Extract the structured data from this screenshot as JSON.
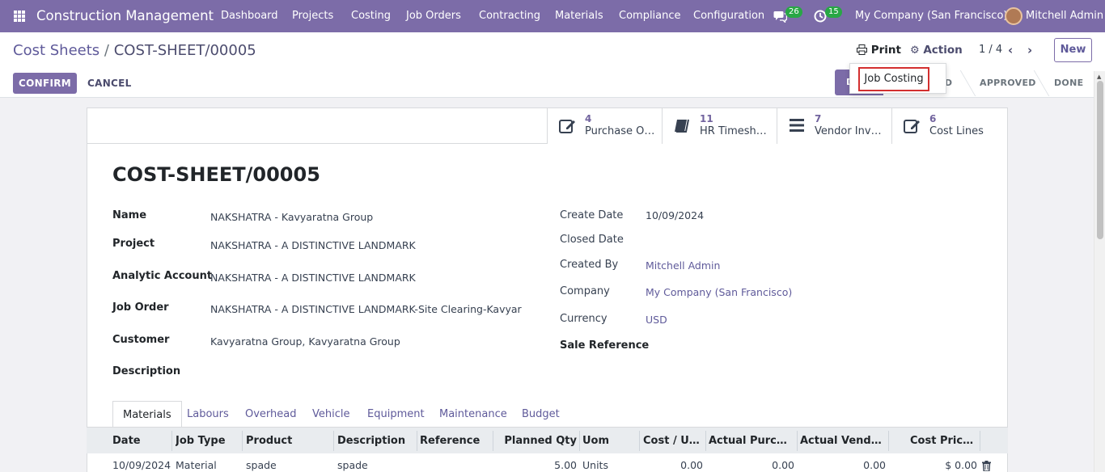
{
  "topbar": {
    "app_title": "Construction Management",
    "menu": [
      "Dashboard",
      "Projects",
      "Costing",
      "Job Orders",
      "Contracting",
      "Materials",
      "Compliance",
      "Configuration"
    ],
    "messages_count": "26",
    "activities_count": "15",
    "company": "My Company (San Francisco)",
    "user": "Mitchell Admin"
  },
  "breadcrumb": {
    "parent": "Cost Sheets",
    "separator": "/",
    "current": "COST-SHEET/00005"
  },
  "toolbar": {
    "print": "Print",
    "action": "Action",
    "pager": "1 / 4",
    "new": "New"
  },
  "actions": {
    "confirm": "CONFIRM",
    "cancel": "CANCEL"
  },
  "print_menu": {
    "item": "Job Costing"
  },
  "statusbar": {
    "draft_partial": "D",
    "confirmed_partial": "ED",
    "approved": "APPROVED",
    "done": "DONE"
  },
  "smart_buttons": [
    {
      "count": "4",
      "label": "Purchase O…",
      "icon": "edit-icon"
    },
    {
      "count": "11",
      "label": "HR Timesh…",
      "icon": "book-icon"
    },
    {
      "count": "7",
      "label": "Vendor Inv…",
      "icon": "list-icon"
    },
    {
      "count": "6",
      "label": "Cost Lines",
      "icon": "edit-icon"
    }
  ],
  "record": {
    "title": "COST-SHEET/00005",
    "left": [
      {
        "label": "Name",
        "value": "NAKSHATRA - Kavyaratna Group"
      },
      {
        "label": "Project",
        "value": "NAKSHATRA - A DISTINCTIVE LANDMARK"
      },
      {
        "label": "Analytic Account",
        "value": "NAKSHATRA - A DISTINCTIVE LANDMARK"
      },
      {
        "label": "Job Order",
        "value": "NAKSHATRA - A DISTINCTIVE LANDMARK-Site Clearing-Kavyar"
      },
      {
        "label": "Customer",
        "value": "Kavyaratna Group, Kavyaratna Group"
      },
      {
        "label": "Description",
        "value": ""
      }
    ],
    "right": [
      {
        "label": "Create Date",
        "value": "10/09/2024"
      },
      {
        "label": "Closed Date",
        "value": ""
      },
      {
        "label": "Created By",
        "value": "Mitchell Admin"
      },
      {
        "label": "Company",
        "value": "My Company (San Francisco)"
      },
      {
        "label": "Currency",
        "value": "USD"
      },
      {
        "label": "Sale Reference",
        "value": ""
      }
    ]
  },
  "tabs": [
    "Materials",
    "Labours",
    "Overhead",
    "Vehicle",
    "Equipment",
    "Maintenance",
    "Budget"
  ],
  "table": {
    "columns": [
      "Date",
      "Job Type",
      "Product",
      "Description",
      "Reference",
      "Planned Qty",
      "Uom",
      "Cost / Unit",
      "Actual Purchas…",
      "Actual Vendor …",
      "Cost Price …"
    ],
    "rows": [
      [
        "10/09/2024",
        "Material",
        "spade",
        "spade",
        "",
        "5.00",
        "Units",
        "0.00",
        "0.00",
        "0.00",
        "$ 0.00"
      ]
    ]
  }
}
